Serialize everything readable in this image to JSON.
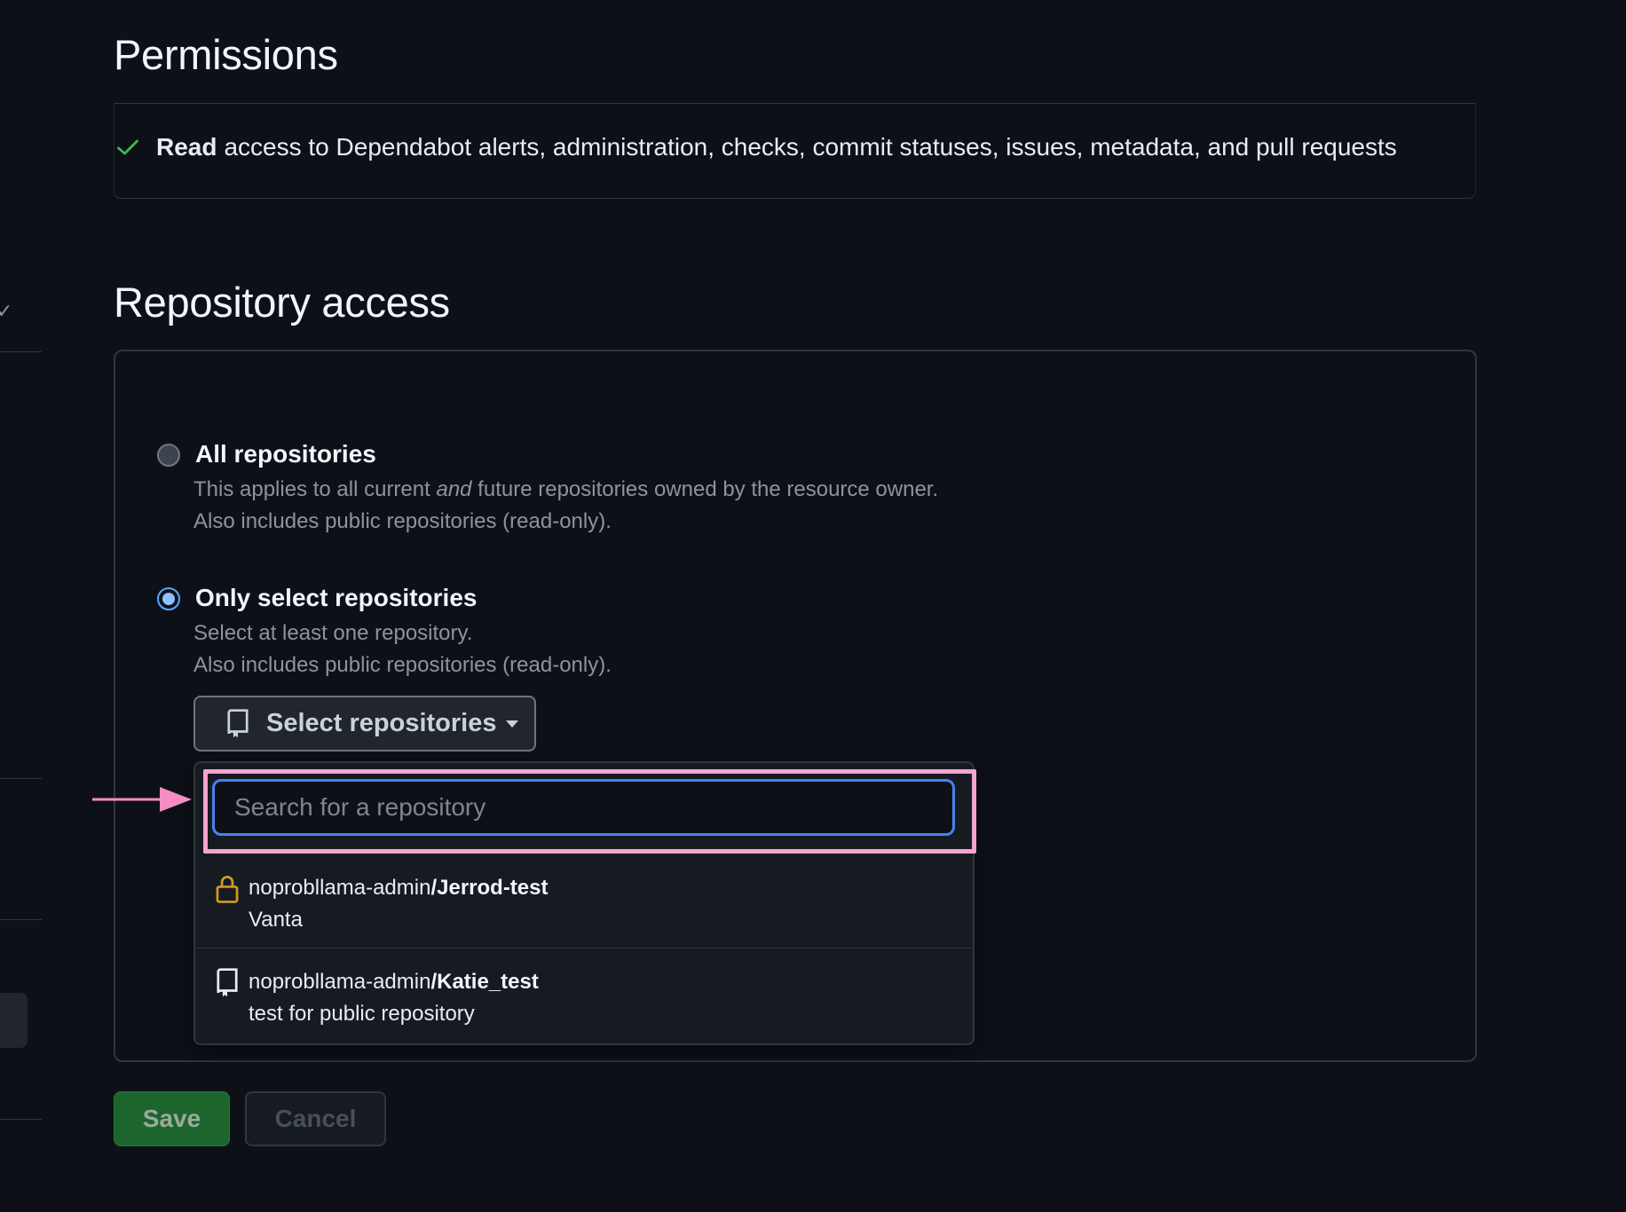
{
  "permissions": {
    "title": "Permissions",
    "access_level": "Read",
    "access_text": "access to Dependabot alerts, administration, checks, commit statuses, issues, metadata, and pull requests"
  },
  "repository_access": {
    "title": "Repository access",
    "options": [
      {
        "label": "All repositories",
        "desc_line1_pre": "This applies to all current ",
        "desc_line1_em": "and",
        "desc_line1_post": " future repositories owned by the resource owner.",
        "desc_line2": "Also includes public repositories (read-only).",
        "selected": false
      },
      {
        "label": "Only select repositories",
        "desc_line1": "Select at least one repository.",
        "desc_line2": "Also includes public repositories (read-only).",
        "selected": true
      }
    ],
    "select_button_label": "Select repositories",
    "search": {
      "placeholder": "Search for a repository",
      "value": ""
    },
    "repositories": [
      {
        "owner": "noprobllama-admin",
        "name": "/Jerrod-test",
        "description": "Vanta",
        "icon": "lock-icon",
        "private": true
      },
      {
        "owner": "noprobllama-admin",
        "name": "/Katie_test",
        "description": "test for public repository",
        "icon": "repo-icon",
        "private": false
      }
    ]
  },
  "actions": {
    "save_label": "Save",
    "cancel_label": "Cancel"
  },
  "colors": {
    "background": "#0d1117",
    "check": "#3fb950",
    "focus_border": "#4a80f0",
    "highlight_annotation": "#f5a3cf",
    "lock": "#d29922",
    "save": "#238636"
  }
}
